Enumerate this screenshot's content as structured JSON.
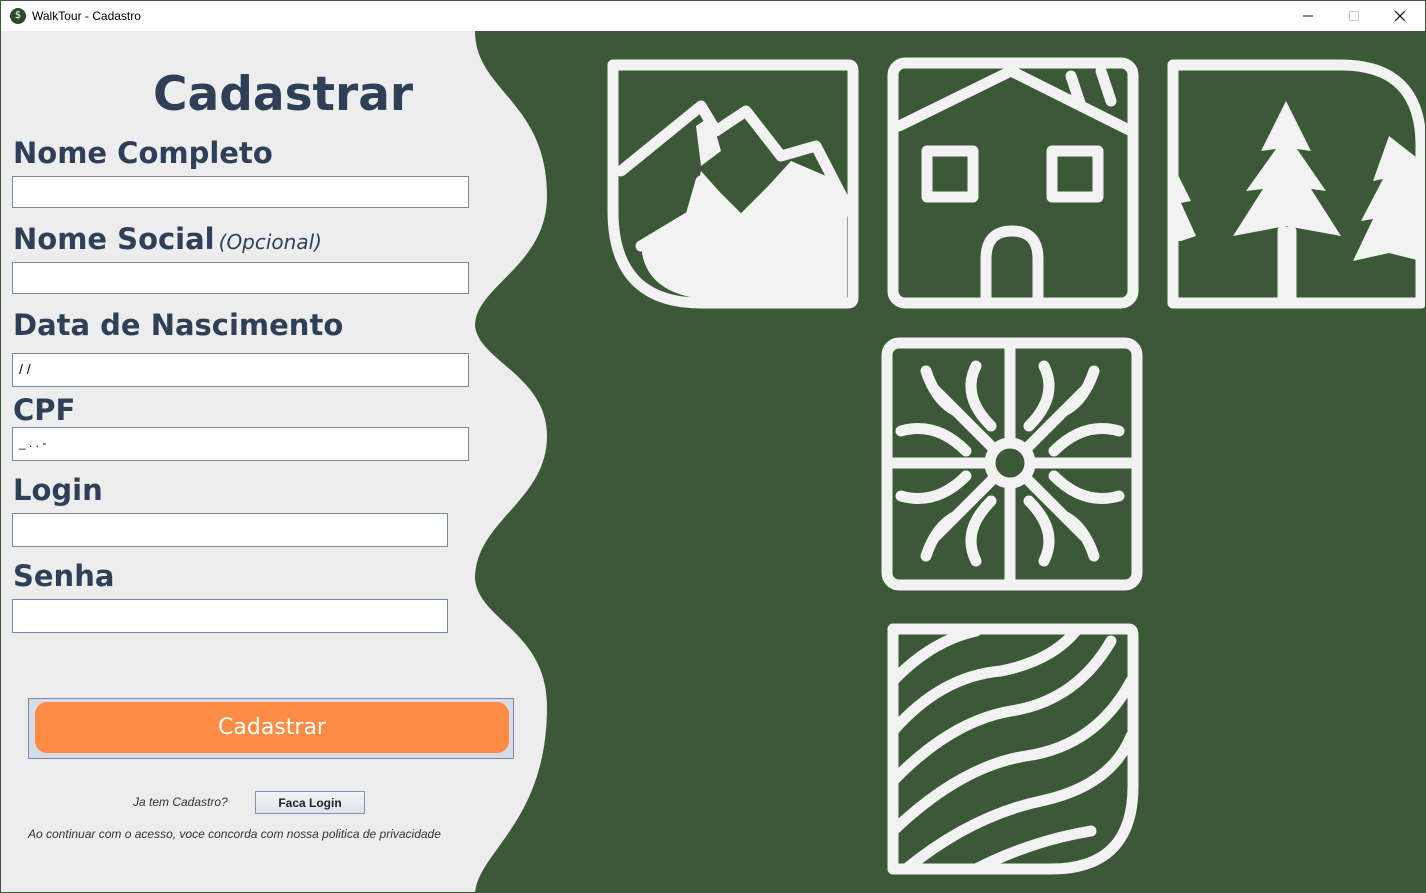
{
  "window": {
    "title": "WalkTour - Cadastro",
    "app_icon": "walktour-logo",
    "controls": [
      "minimize-icon",
      "maximize-icon",
      "close-icon"
    ]
  },
  "form": {
    "heading": "Cadastrar",
    "fields": {
      "nome_completo": {
        "label": "Nome Completo",
        "value": ""
      },
      "nome_social": {
        "label": "Nome Social",
        "optional_note": "(Opcional)",
        "value": ""
      },
      "data_nascimento": {
        "label": "Data de Nascimento",
        "value": "/ /"
      },
      "cpf": {
        "label": "CPF",
        "value": "_ . . -"
      },
      "login": {
        "label": "Login",
        "value": ""
      },
      "senha": {
        "label": "Senha",
        "value": ""
      }
    },
    "submit_label": "Cadastrar",
    "has_account_text": "Ja tem Cadastro?",
    "login_link_label": "Faca Login",
    "policy_text": "Ao continuar com o acesso, voce concorda com nossa politica de privacidade"
  },
  "colors": {
    "panel_bg": "#ededed",
    "decor_bg": "#3b5837",
    "heading_text": "#2f3f58",
    "accent_button": "#ff8c45",
    "decor_line": "#f2f2f2"
  },
  "decor_icons": [
    "mountain-icon",
    "house-icon",
    "pine-trees-icon",
    "snowflake-icon",
    "waves-field-icon"
  ]
}
